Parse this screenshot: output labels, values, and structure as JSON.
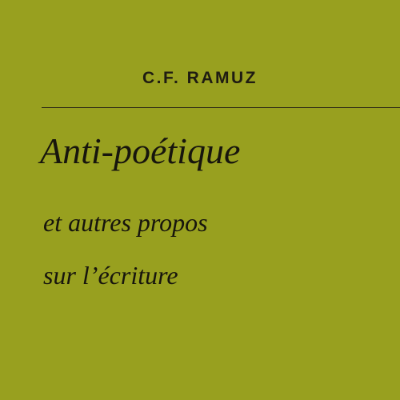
{
  "cover": {
    "author": "C.F. RAMUZ",
    "title": "Anti-poétique",
    "subtitle_lines": [
      "et autres propos",
      "sur l’écriture"
    ],
    "background_color": "#98a01f",
    "text_color": "#17150d"
  }
}
